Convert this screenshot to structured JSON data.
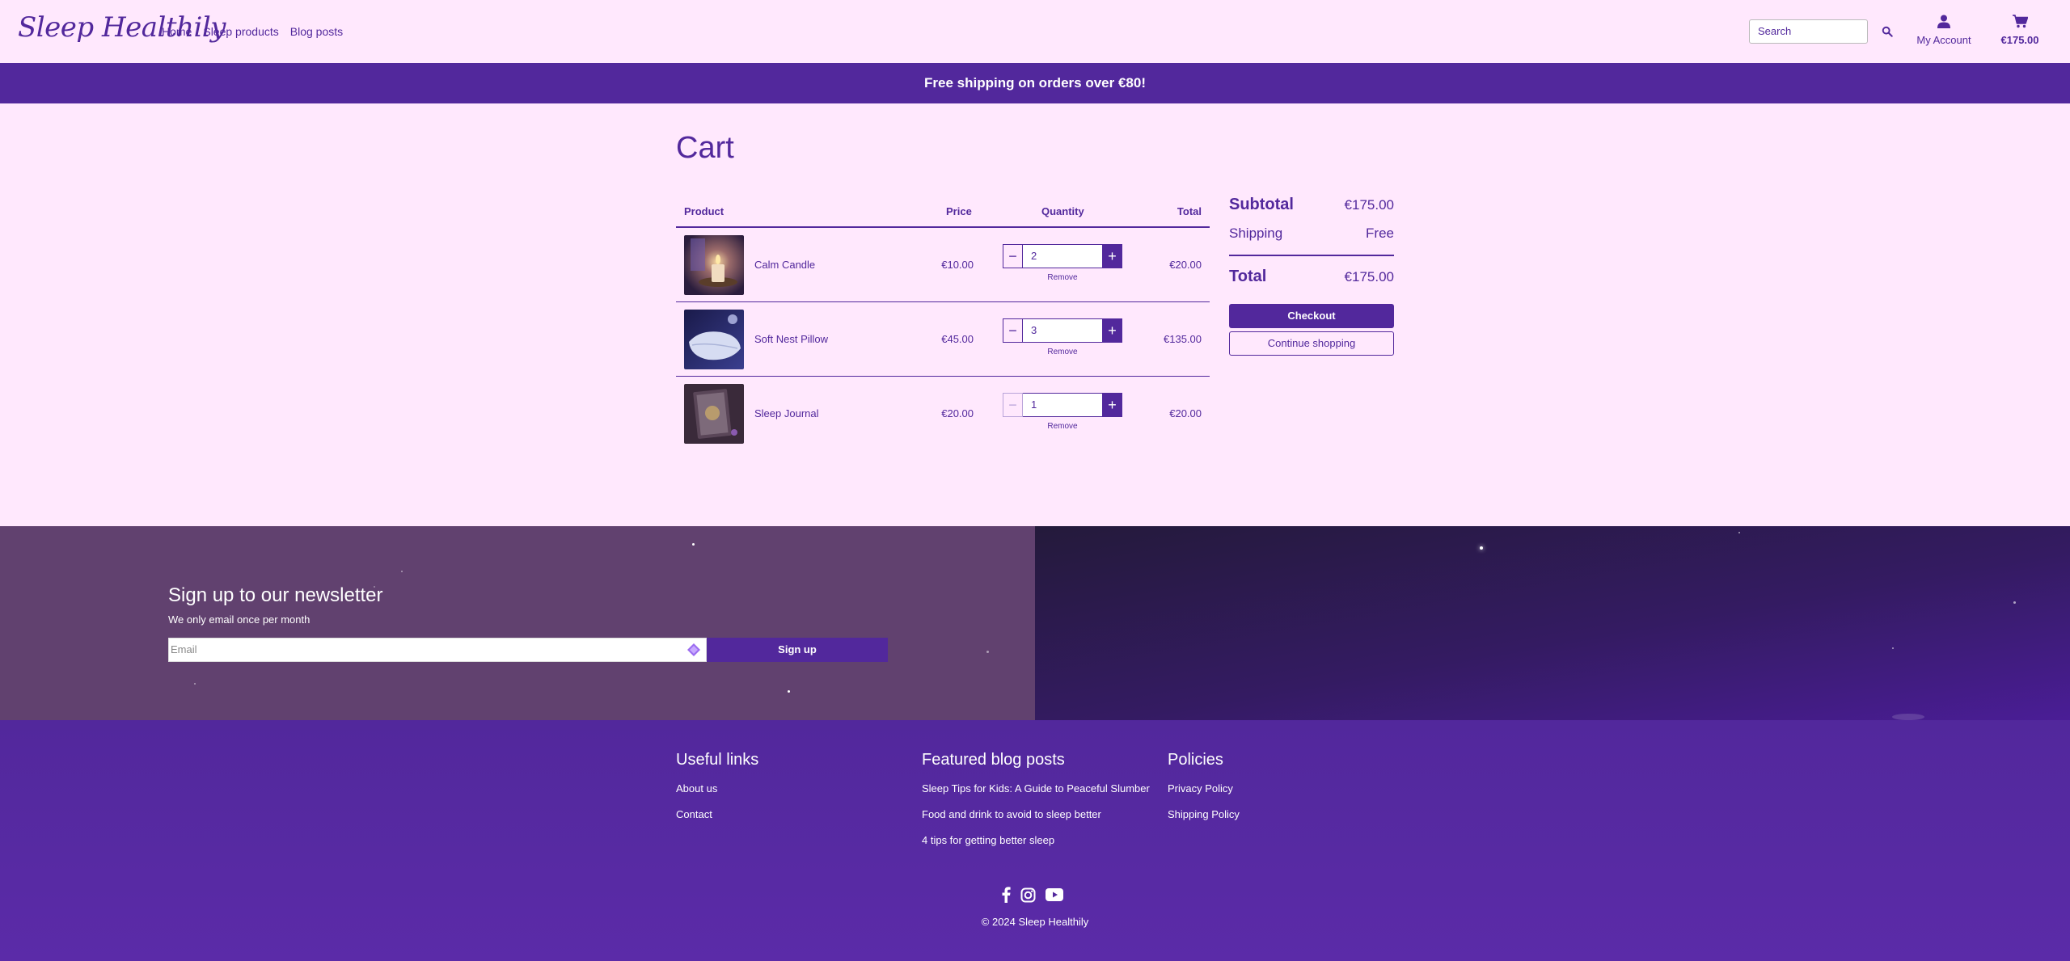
{
  "header": {
    "logo": "Sleep Healthily",
    "nav": [
      "Home",
      "Sleep products",
      "Blog posts"
    ],
    "search_placeholder": "Search",
    "account_label": "My Account",
    "cart_total": "€175.00"
  },
  "banner": {
    "text": "Free shipping on orders over €80!"
  },
  "cart": {
    "title": "Cart",
    "headers": {
      "product": "Product",
      "price": "Price",
      "quantity": "Quantity",
      "total": "Total"
    },
    "items": [
      {
        "name": "Calm Candle",
        "price": "€10.00",
        "quantity": "2",
        "remove": "Remove",
        "total": "€20.00"
      },
      {
        "name": "Soft Nest Pillow",
        "price": "€45.00",
        "quantity": "3",
        "remove": "Remove",
        "total": "€135.00"
      },
      {
        "name": "Sleep Journal",
        "price": "€20.00",
        "quantity": "1",
        "remove": "Remove",
        "total": "€20.00"
      }
    ]
  },
  "summary": {
    "subtotal_label": "Subtotal",
    "subtotal_value": "€175.00",
    "shipping_label": "Shipping",
    "shipping_value": "Free",
    "total_label": "Total",
    "total_value": "€175.00",
    "checkout": "Checkout",
    "continue": "Continue shopping"
  },
  "newsletter": {
    "title": "Sign up to our newsletter",
    "subtitle": "We only email once per month",
    "email_placeholder": "Email",
    "button": "Sign up"
  },
  "footer": {
    "useful_title": "Useful links",
    "useful_links": [
      "About us",
      "Contact"
    ],
    "blog_title": "Featured blog posts",
    "blog_links": [
      "Sleep Tips for Kids: A Guide to Peaceful Slumber",
      "Food and drink to avoid to sleep better",
      "4 tips for getting better sleep"
    ],
    "policies_title": "Policies",
    "policy_links": [
      "Privacy Policy",
      "Shipping Policy"
    ],
    "copyright": "© 2024 Sleep Healthily"
  },
  "colors": {
    "brand": "#52289c",
    "background": "#ffe8fd",
    "newsletter_left": "#61416f"
  }
}
